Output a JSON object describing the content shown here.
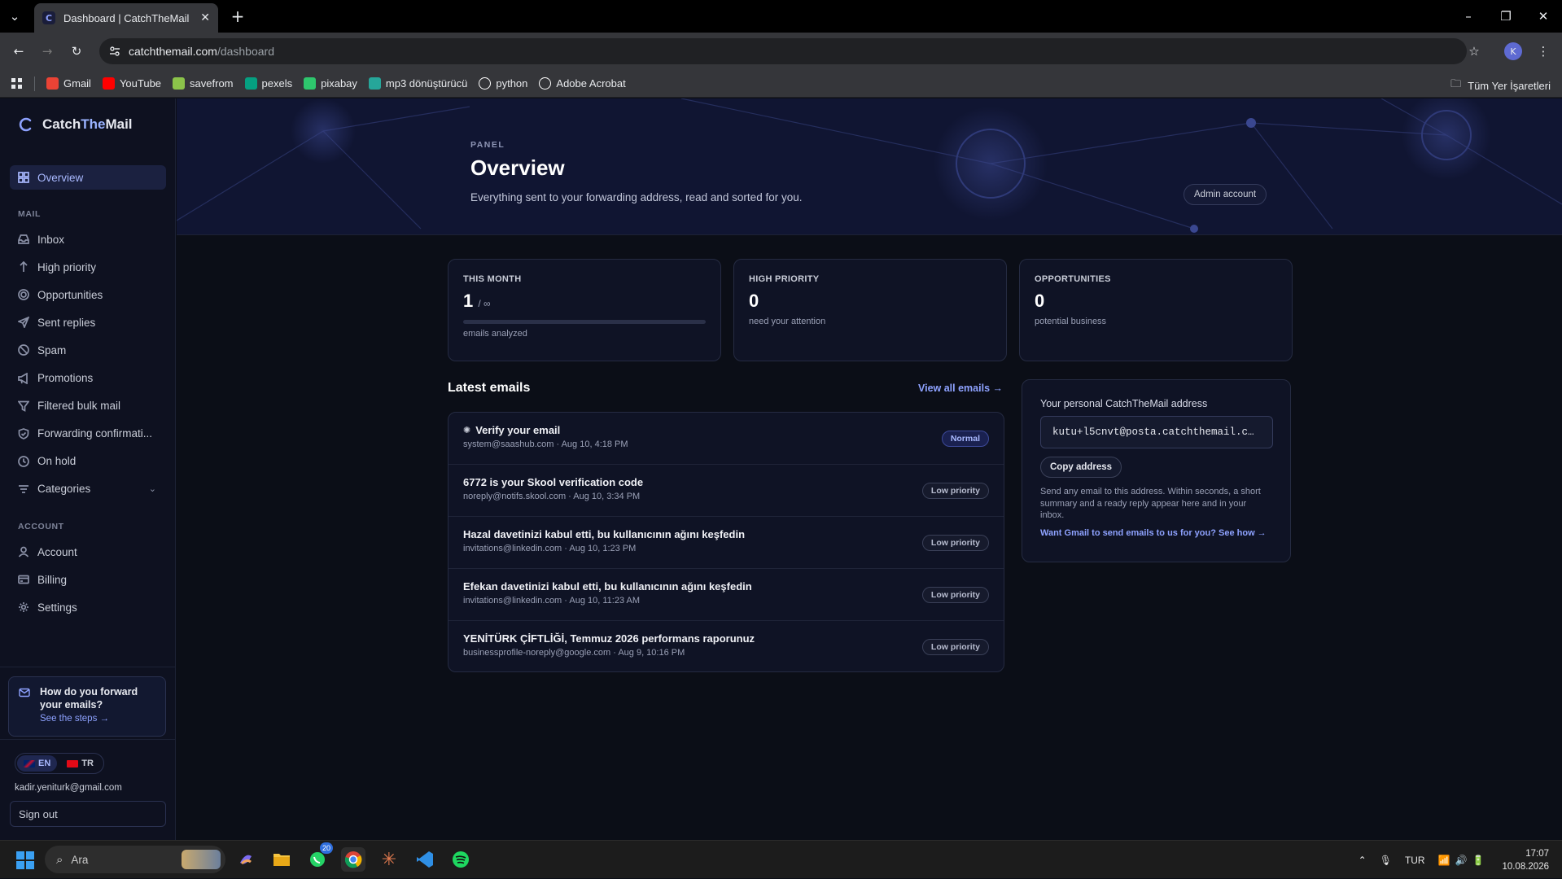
{
  "browser": {
    "tab_title": "Dashboard | CatchTheMail",
    "url_host": "catchthemail.com",
    "url_path": "/dashboard",
    "profile_initial": "K",
    "bookmarks": [
      {
        "label": "Gmail",
        "icon": "gmail-icon",
        "color": "#ea4335"
      },
      {
        "label": "YouTube",
        "icon": "youtube-icon",
        "color": "#ff0000"
      },
      {
        "label": "savefrom",
        "icon": "savefrom-icon",
        "color": "#8bc34a"
      },
      {
        "label": "pexels",
        "icon": "pexels-icon",
        "color": "#05a081"
      },
      {
        "label": "pixabay",
        "icon": "pixabay-icon",
        "color": "#2ec66d"
      },
      {
        "label": "mp3 dönüştürücü",
        "icon": "mp3-converter-icon",
        "color": "#26a69a"
      },
      {
        "label": "python",
        "icon": "python-icon",
        "color": "#ffffff"
      },
      {
        "label": "Adobe Acrobat",
        "icon": "acrobat-icon",
        "color": "#ffffff"
      }
    ],
    "all_bookmarks_label": "Tüm Yer İşaretleri"
  },
  "sidebar": {
    "brand_catch": "Catch",
    "brand_the": "The",
    "brand_mail": "Mail",
    "overview_label": "Overview",
    "mail_section": "MAIL",
    "mail_items": [
      {
        "label": "Inbox",
        "icon": "inbox-icon"
      },
      {
        "label": "High priority",
        "icon": "arrow-up-icon"
      },
      {
        "label": "Opportunities",
        "icon": "target-icon"
      },
      {
        "label": "Sent replies",
        "icon": "send-icon"
      },
      {
        "label": "Spam",
        "icon": "ban-icon"
      },
      {
        "label": "Promotions",
        "icon": "megaphone-icon"
      },
      {
        "label": "Filtered bulk mail",
        "icon": "filter-icon"
      },
      {
        "label": "Forwarding confirmati...",
        "icon": "shield-check-icon"
      },
      {
        "label": "On hold",
        "icon": "clock-icon"
      },
      {
        "label": "Categories",
        "icon": "list-icon"
      }
    ],
    "account_section": "ACCOUNT",
    "account_items": [
      {
        "label": "Account",
        "icon": "user-icon"
      },
      {
        "label": "Billing",
        "icon": "card-icon"
      },
      {
        "label": "Settings",
        "icon": "gear-icon"
      }
    ],
    "help_question": "How do you forward your emails?",
    "help_link": "See the steps →",
    "lang_en": "EN",
    "lang_tr": "TR",
    "user_email": "kadir.yeniturk@gmail.com",
    "sign_out": "Sign out"
  },
  "hero": {
    "eyebrow": "PANEL",
    "title": "Overview",
    "subtitle": "Everything sent to your forwarding address, read and sorted for you.",
    "admin_badge": "Admin account"
  },
  "stats": [
    {
      "label": "THIS MONTH",
      "value": "1",
      "of": "/ ∞",
      "caption": "emails analyzed",
      "progress": 0.0
    },
    {
      "label": "HIGH PRIORITY",
      "value": "0",
      "caption": "need your attention"
    },
    {
      "label": "OPPORTUNITIES",
      "value": "0",
      "caption": "potential business"
    }
  ],
  "latest": {
    "heading": "Latest emails",
    "view_all": "View all emails →",
    "emails": [
      {
        "subject": "Verify your email",
        "icon": "sparkle-icon",
        "meta": "system@saashub.com · Aug 10, 4:18 PM",
        "badge": "Normal",
        "badge_type": "normal"
      },
      {
        "subject": "6772 is your Skool verification code",
        "meta": "noreply@notifs.skool.com · Aug 10, 3:34 PM",
        "badge": "Low priority",
        "badge_type": "low"
      },
      {
        "subject": "Hazal davetinizi kabul etti, bu kullanıcının ağını keşfedin",
        "meta": "invitations@linkedin.com · Aug 10, 1:23 PM",
        "badge": "Low priority",
        "badge_type": "low"
      },
      {
        "subject": "Efekan davetinizi kabul etti, bu kullanıcının ağını keşfedin",
        "meta": "invitations@linkedin.com · Aug 10, 11:23 AM",
        "badge": "Low priority",
        "badge_type": "low"
      },
      {
        "subject": "YENİTÜRK ÇİFTLİĞİ, Temmuz 2026 performans raporunuz",
        "meta": "businessprofile-noreply@google.com · Aug 9, 10:16 PM",
        "badge": "Low priority",
        "badge_type": "low"
      }
    ]
  },
  "address_card": {
    "title": "Your personal CatchTheMail address",
    "address": "kutu+l5cnvt@posta.catchthemail.c…",
    "copy_button": "Copy address",
    "description": "Send any email to this address. Within seconds, a short summary and a ready reply appear here and in your inbox.",
    "gmail_link": "Want Gmail to send emails to us for you? See how →"
  },
  "taskbar": {
    "search_placeholder": "Ara",
    "whatsapp_badge": "20",
    "lang": "TUR",
    "time": "17:07",
    "date": "10.08.2026"
  },
  "colors": {
    "accent": "#8ea2ff",
    "background": "#0b0e17",
    "sidebar": "#0e1120",
    "card": "#0f1325"
  }
}
